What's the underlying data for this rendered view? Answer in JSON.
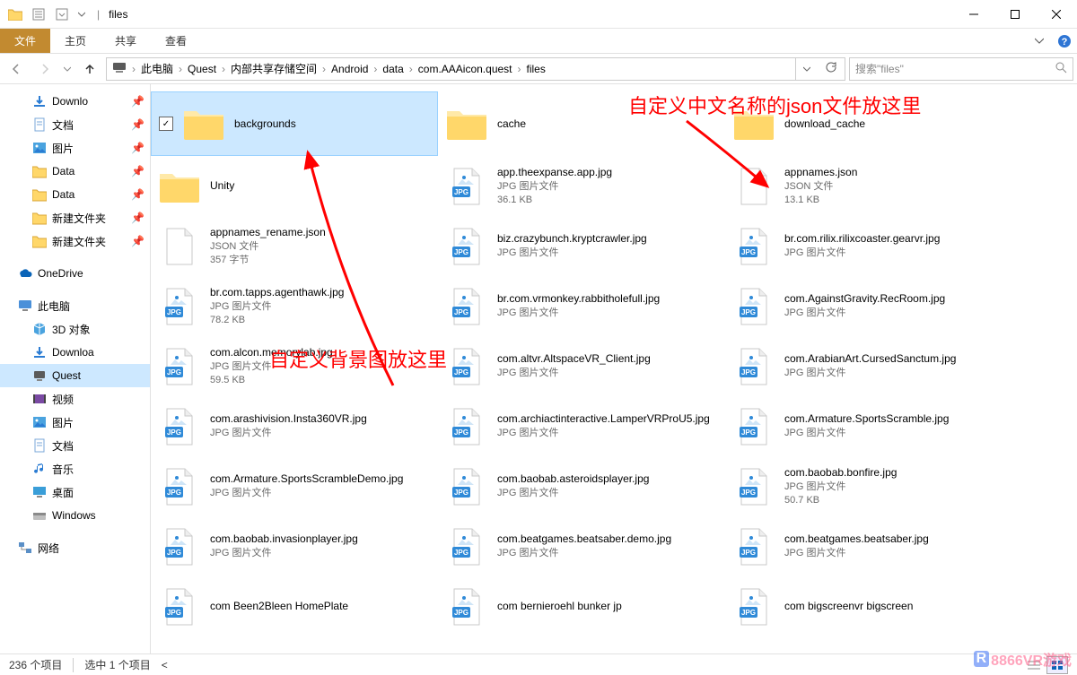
{
  "window": {
    "title": "files",
    "title_sep": "|"
  },
  "ribbon": {
    "file": "文件",
    "tabs": [
      "主页",
      "共享",
      "查看"
    ]
  },
  "breadcrumb": {
    "items": [
      "此电脑",
      "Quest",
      "内部共享存储空间",
      "Android",
      "data",
      "com.AAAicon.quest",
      "files"
    ]
  },
  "search": {
    "placeholder": "搜索\"files\""
  },
  "tree": {
    "quick": [
      {
        "icon": "downloads",
        "label": "Downlo"
      },
      {
        "icon": "doc",
        "label": "文档"
      },
      {
        "icon": "pictures",
        "label": "图片"
      },
      {
        "icon": "folder",
        "label": "Data"
      },
      {
        "icon": "folder",
        "label": "Data"
      },
      {
        "icon": "folder",
        "label": "新建文件夹"
      },
      {
        "icon": "folder",
        "label": "新建文件夹"
      }
    ],
    "onedrive": "OneDrive",
    "thispc": "此电脑",
    "pc_items": [
      {
        "icon": "3d",
        "label": "3D 对象"
      },
      {
        "icon": "downloads",
        "label": "Downloa"
      },
      {
        "icon": "device",
        "label": "Quest",
        "selected": true
      },
      {
        "icon": "video",
        "label": "视频"
      },
      {
        "icon": "pictures",
        "label": "图片"
      },
      {
        "icon": "doc",
        "label": "文档"
      },
      {
        "icon": "music",
        "label": "音乐"
      },
      {
        "icon": "desktop",
        "label": "桌面"
      },
      {
        "icon": "disk",
        "label": "Windows"
      }
    ],
    "network": "网络"
  },
  "files": [
    {
      "type": "folder",
      "name": "backgrounds",
      "selected": true
    },
    {
      "type": "folder",
      "name": "Unity"
    },
    {
      "type": "json",
      "name": "appnames_rename.json",
      "sub1": "JSON 文件",
      "sub2": "357 字节"
    },
    {
      "type": "jpg",
      "name": "br.com.tapps.agenthawk.jpg",
      "sub1": "JPG 图片文件",
      "sub2": "78.2 KB"
    },
    {
      "type": "jpg",
      "name": "com.alcon.memorylab.jpg",
      "sub1": "JPG 图片文件",
      "sub2": "59.5 KB"
    },
    {
      "type": "jpg",
      "name": "com.arashivision.Insta360VR.jpg",
      "sub1": "JPG 图片文件"
    },
    {
      "type": "jpg",
      "name": "com.Armature.SportsScrambleDemo.jpg",
      "sub1": "JPG 图片文件"
    },
    {
      "type": "jpg",
      "name": "com.baobab.invasionplayer.jpg",
      "sub1": "JPG 图片文件"
    },
    {
      "type": "jpg",
      "name": "com Been2Bleen HomePlate",
      "cut": true
    },
    {
      "type": "folder",
      "name": "cache"
    },
    {
      "type": "jpg",
      "name": "app.theexpanse.app.jpg",
      "sub1": "JPG 图片文件",
      "sub2": "36.1 KB"
    },
    {
      "type": "jpg",
      "name": "biz.crazybunch.kryptcrawler.jpg",
      "sub1": "JPG 图片文件"
    },
    {
      "type": "jpg",
      "name": "br.com.vrmonkey.rabbitholefull.jpg",
      "sub1": "JPG 图片文件"
    },
    {
      "type": "jpg",
      "name": "com.altvr.AltspaceVR_Client.jpg",
      "sub1": "JPG 图片文件"
    },
    {
      "type": "jpg",
      "name": "com.archiactinteractive.LamperVRProU5.jpg",
      "sub1": "JPG 图片文件"
    },
    {
      "type": "jpg",
      "name": "com.baobab.asteroidsplayer.jpg",
      "sub1": "JPG 图片文件"
    },
    {
      "type": "jpg",
      "name": "com.beatgames.beatsaber.demo.jpg",
      "sub1": "JPG 图片文件"
    },
    {
      "type": "jpg",
      "name": "com bernieroehl bunker jp",
      "cut": true
    },
    {
      "type": "folder",
      "name": "download_cache"
    },
    {
      "type": "json",
      "name": "appnames.json",
      "sub1": "JSON 文件",
      "sub2": "13.1 KB"
    },
    {
      "type": "jpg",
      "name": "br.com.rilix.rilixcoaster.gearvr.jpg",
      "sub1": "JPG 图片文件"
    },
    {
      "type": "jpg",
      "name": "com.AgainstGravity.RecRoom.jpg",
      "sub1": "JPG 图片文件"
    },
    {
      "type": "jpg",
      "name": "com.ArabianArt.CursedSanctum.jpg",
      "sub1": "JPG 图片文件"
    },
    {
      "type": "jpg",
      "name": "com.Armature.SportsScramble.jpg",
      "sub1": "JPG 图片文件"
    },
    {
      "type": "jpg",
      "name": "com.baobab.bonfire.jpg",
      "sub1": "JPG 图片文件",
      "sub2": "50.7 KB"
    },
    {
      "type": "jpg",
      "name": "com.beatgames.beatsaber.jpg",
      "sub1": "JPG 图片文件"
    },
    {
      "type": "jpg",
      "name": "com bigscreenvr bigscreen",
      "cut": true
    }
  ],
  "status": {
    "count": "236 个项目",
    "selected": "选中 1 个项目"
  },
  "annotations": {
    "top": "自定义中文名称的json文件放这里",
    "mid": "自定义背景图放这里"
  },
  "watermark": "8866VR游戏"
}
